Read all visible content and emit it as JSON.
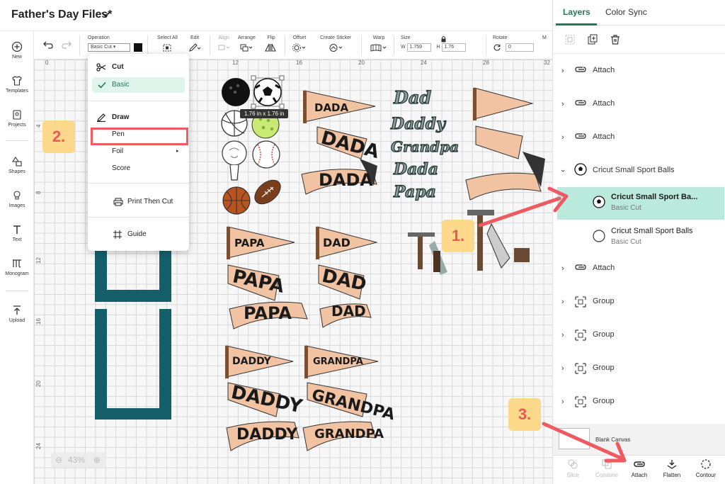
{
  "header": {
    "project_title": "Father's Day Files*"
  },
  "sidebar": {
    "items": [
      {
        "label": "New",
        "icon": "plus-circle-icon"
      },
      {
        "label": "Templates",
        "icon": "shirt-icon"
      },
      {
        "label": "Projects",
        "icon": "projects-icon"
      },
      {
        "label": "Shapes",
        "icon": "shapes-icon"
      },
      {
        "label": "Images",
        "icon": "lightbulb-icon"
      },
      {
        "label": "Text",
        "icon": "text-icon"
      },
      {
        "label": "Monogram",
        "icon": "monogram-icon"
      },
      {
        "label": "Upload",
        "icon": "upload-icon"
      }
    ]
  },
  "toolbar": {
    "operation_label": "Operation",
    "operation_value": "Basic Cut",
    "select_all_label": "Select All",
    "edit_label": "Edit",
    "align_label": "Align",
    "arrange_label": "Arrange",
    "flip_label": "Flip",
    "offset_label": "Offset",
    "create_sticker_label": "Create Sticker",
    "warp_label": "Warp",
    "size_label": "Size",
    "width_prefix": "W",
    "width_value": "1.759",
    "height_prefix": "H",
    "height_value": "1.76",
    "rotate_label": "Rotate",
    "rotate_value": "0",
    "more_label": "M"
  },
  "ruler": {
    "top": [
      "0",
      "4",
      "8",
      "12",
      "16",
      "20",
      "24",
      "28",
      "32"
    ],
    "left": [
      "4",
      "8",
      "12",
      "16",
      "20",
      "24"
    ]
  },
  "operation_menu": {
    "cut_header": "Cut",
    "basic": "Basic",
    "draw_header": "Draw",
    "pen": "Pen",
    "foil": "Foil",
    "score": "Score",
    "print_then_cut": "Print Then Cut",
    "guide": "Guide"
  },
  "canvas": {
    "size_tooltip": "1.76  in x 1.76  in",
    "pennants": {
      "dada": "DADA",
      "papa": "PAPA",
      "dad": "DAD",
      "daddy": "DADDY",
      "grandpa": "GRANDPA",
      "pa_suffix": "PA",
      "a_suffix": "A",
      "dy_suffix": "DY",
      "dad_script": [
        "Dad",
        "Daddy",
        "Grandpa",
        "Dada",
        "Papa"
      ]
    },
    "zoom": "43%"
  },
  "layers_panel": {
    "tabs": [
      "Layers",
      "Color Sync"
    ],
    "layers": [
      {
        "type": "Attach",
        "expanded": false
      },
      {
        "type": "Attach",
        "expanded": false
      },
      {
        "type": "Attach",
        "expanded": false
      },
      {
        "type": "Cricut Small Sport Balls",
        "expanded": true
      },
      {
        "type": "Attach",
        "expanded": false
      },
      {
        "type": "Group",
        "expanded": false
      },
      {
        "type": "Group",
        "expanded": false
      },
      {
        "type": "Group",
        "expanded": false
      },
      {
        "type": "Group",
        "expanded": false
      }
    ],
    "sub_layers": [
      {
        "name": "Cricut Small Sport Ba...",
        "operation": "Basic Cut",
        "selected": true
      },
      {
        "name": "Cricut Small Sport Balls",
        "operation": "Basic Cut",
        "selected": false
      }
    ],
    "blank_canvas": "Blank Canvas",
    "actions": [
      "Slice",
      "Combine",
      "Attach",
      "Flatten",
      "Contour"
    ]
  },
  "callouts": [
    "1.",
    "2.",
    "3."
  ],
  "colors": {
    "accent_green": "#1e7b54",
    "selected_row": "#b9eadb",
    "callout_bg": "#fbd88a",
    "callout_text": "#e85a5a",
    "arrow_red": "#ef5a62",
    "pennant_peach": "#f2c3a2",
    "teal_frame": "#145f6a"
  }
}
